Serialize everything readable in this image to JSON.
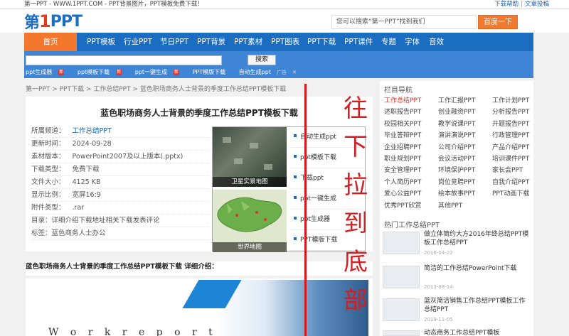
{
  "topbar": {
    "left_text": "第一PPT - WWW.1PPT.COM - PPT背景图片，PPT模板免费下载！",
    "links": [
      "下载帮助",
      "文章投稿"
    ],
    "sep": "|"
  },
  "logo": {
    "text1": "第",
    "text2": "1",
    "text3": "PPT"
  },
  "search": {
    "placeholder": "您可以搜索“第一PPT”找到我们",
    "button": "百度一下"
  },
  "nav": {
    "items": [
      "首页",
      "PPT模板",
      "行业PPT",
      "节日PPT",
      "PPT背景",
      "PPT素材",
      "PPT图表",
      "PPT下载",
      "PPT课件",
      "专题",
      "字体",
      "音效"
    ]
  },
  "subbar": {
    "button": "搜索",
    "new_badge": "新",
    "hot": [
      "ppt生成器",
      "ppt模板下载",
      "ppt一键生成",
      "PPT模版下载",
      "自动生成ppt"
    ],
    "ad": "广告"
  },
  "breadcrumb": "第一PPT > PPT下载 > 工作总结PPT > 蓝色职场商务人士背景的季度工作总结PPT模板下载",
  "article": {
    "title": "蓝色职场商务人士背景的季度工作总结PPT模板下载",
    "meta": [
      {
        "k": "所属频道：",
        "v": "工作总结PPT",
        "link": true
      },
      {
        "k": "更新时间：",
        "v": "2024-09-28"
      },
      {
        "k": "素材版本：",
        "v": "PowerPoint2007及以上版本(.pptx)"
      },
      {
        "k": "下载类型：",
        "v": "免费下载"
      },
      {
        "k": "文件大小：",
        "v": "4125 KB"
      },
      {
        "k": "显示比例：",
        "v": "宽屏16:9"
      },
      {
        "k": "附件类型：",
        "v": ".rar"
      }
    ],
    "toc_label": "目录：",
    "toc": [
      "详细介绍",
      "下载地址",
      "相关下载",
      "发表评论"
    ],
    "tags_label": "标签：",
    "tags": [
      "蓝色",
      "商务人士",
      "办公"
    ],
    "intro": "蓝色职场商务人士背景的季度工作总结PPT模板下载 详细介绍：",
    "preview_text": "W o r k  r e p o r t"
  },
  "thumbs": {
    "cap1": "卫星实景地图",
    "cap2": "世界地图"
  },
  "thumb_links": [
    "自动生成ppt",
    "ppt模板下载",
    "下载ppt",
    "ppt一键生成",
    "ppt生成器",
    "PPT模版下载"
  ],
  "right": {
    "title": "栏目导航",
    "categories": [
      "工作总结PPT",
      "工作汇报PPT",
      "工作计划PPT",
      "述职报告PPT",
      "创业融资PPT",
      "分析报告PPT",
      "校园相关PPT",
      "教学说课PPT",
      "开题报告PPT",
      "毕业答辩PPT",
      "演讲演说PPT",
      "行政管理PPT",
      "企业招聘PPT",
      "公司介绍PPT",
      "产品介绍PPT",
      "职业规划PPT",
      "会议活动PPT",
      "培训课件PPT",
      "安全管理PPT",
      "环境保护PPT",
      "家长会PPT",
      "个人简历PPT",
      "岗位竞聘PPT",
      "自我介绍PPT",
      "爱心公益PPT",
      "绘本故事PPT",
      "PPT动画下载",
      "优秀PPT欣赏",
      "其他PPT"
    ],
    "hot_title": "热门工作总结PPT",
    "hot": [
      {
        "t": "做立体简约大方2016年终总结PPT模板工作总结PPT",
        "d": "2016-04-22"
      },
      {
        "t": "简洁的工作总结PowerPoint下载",
        "d": "2013-08-14"
      },
      {
        "t": "蓝灰简洁销售工作总结PPT模板工作总结PPT",
        "d": "2019-11-05"
      },
      {
        "t": "动态商务工作总结PPT模板",
        "d": ""
      }
    ]
  },
  "overlay": {
    "chars": [
      "往",
      "下",
      "拉",
      "到",
      "底",
      "部"
    ]
  }
}
